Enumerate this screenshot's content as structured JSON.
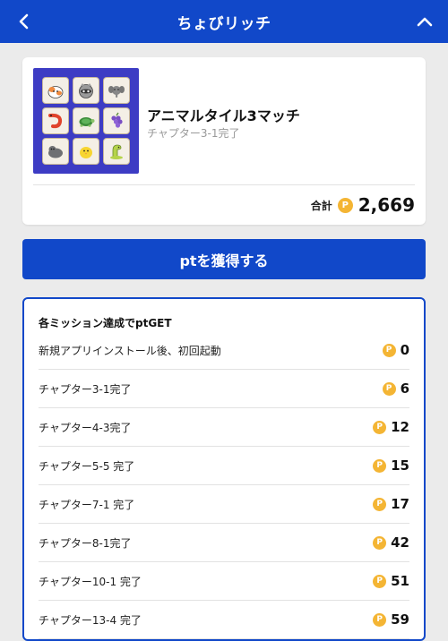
{
  "header": {
    "title": "ちょびリッチ",
    "back_icon": "chevron-left-icon",
    "collapse_icon": "chevron-up-icon"
  },
  "game": {
    "title": "アニマルタイル3マッチ",
    "subtitle": "チャプター3-1完了",
    "thumbnail_tiles": [
      "calico-cat",
      "raccoon",
      "elephant",
      "shrimp",
      "turtle",
      "grapes",
      "seal",
      "chick",
      "dinosaur"
    ],
    "total_label": "合計",
    "coin_symbol": "P",
    "total_points": "2,669"
  },
  "cta": {
    "label": "ptを獲得する"
  },
  "missions": {
    "heading": "各ミッション達成でptGET",
    "items": [
      {
        "label": "新規アプリインストール後、初回起動",
        "points": "0"
      },
      {
        "label": "チャプター3-1完了",
        "points": "6"
      },
      {
        "label": "チャプター4-3完了",
        "points": "12"
      },
      {
        "label": "チャプター5-5 完了",
        "points": "15"
      },
      {
        "label": "チャプター7-1 完了",
        "points": "17"
      },
      {
        "label": "チャプター8-1完了",
        "points": "42"
      },
      {
        "label": "チャプター10-1 完了",
        "points": "51"
      },
      {
        "label": "チャプター13-4 完了",
        "points": "59"
      }
    ]
  },
  "colors": {
    "brand_blue": "#1148c9",
    "coin_gold": "#f4b534",
    "background": "#ebebeb"
  }
}
